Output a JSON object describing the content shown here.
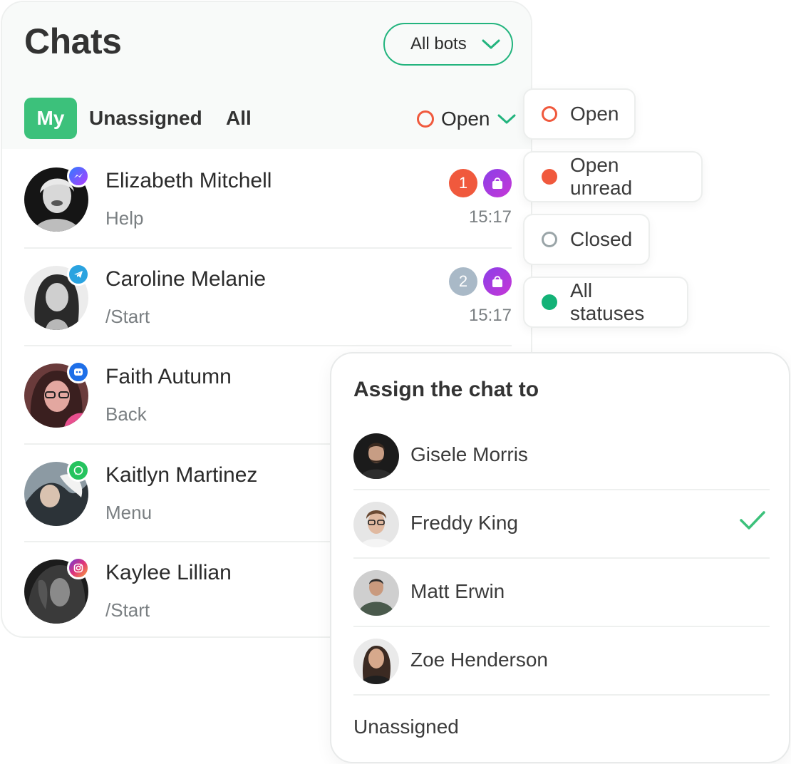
{
  "header": {
    "title": "Chats",
    "bot_filter": "All bots"
  },
  "tabs": [
    {
      "label": "My",
      "active": true
    },
    {
      "label": "Unassigned",
      "active": false
    },
    {
      "label": "All",
      "active": false
    }
  ],
  "status_filter": {
    "value": "Open",
    "options": [
      {
        "label": "Open",
        "color": "#f0593d",
        "style": "ring"
      },
      {
        "label": "Open unread",
        "color": "#f0593d",
        "style": "filled"
      },
      {
        "label": "Closed",
        "color": "#9aa5a8",
        "style": "ring"
      },
      {
        "label": "All statuses",
        "color": "#13b277",
        "style": "filled"
      }
    ]
  },
  "chats": [
    {
      "name": "Elizabeth Mitchell",
      "message": "Help",
      "time": "15:17",
      "unread": "1",
      "unread_color": "#f0593d",
      "channel": "messenger-icon"
    },
    {
      "name": "Caroline Melanie",
      "message": "/Start",
      "time": "15:17",
      "unread": "2",
      "unread_color": "#a9b9c7",
      "channel": "telegram-icon"
    },
    {
      "name": "Faith Autumn",
      "message": "Back",
      "channel": "bot-chat-icon"
    },
    {
      "name": "Kaitlyn Martinez",
      "message": "Menu",
      "channel": "whatsapp-icon"
    },
    {
      "name": "Kaylee Lillian",
      "message": "/Start",
      "channel": "instagram-icon"
    }
  ],
  "assign": {
    "title": "Assign the chat to",
    "agents": [
      {
        "name": "Gisele Morris",
        "selected": false
      },
      {
        "name": "Freddy King",
        "selected": true
      },
      {
        "name": "Matt Erwin",
        "selected": false
      },
      {
        "name": "Zoe Henderson",
        "selected": false
      }
    ],
    "unassigned_label": "Unassigned"
  },
  "colors": {
    "accent": "#3cc17b",
    "accent_border": "#23b47e",
    "danger": "#f0593d"
  }
}
